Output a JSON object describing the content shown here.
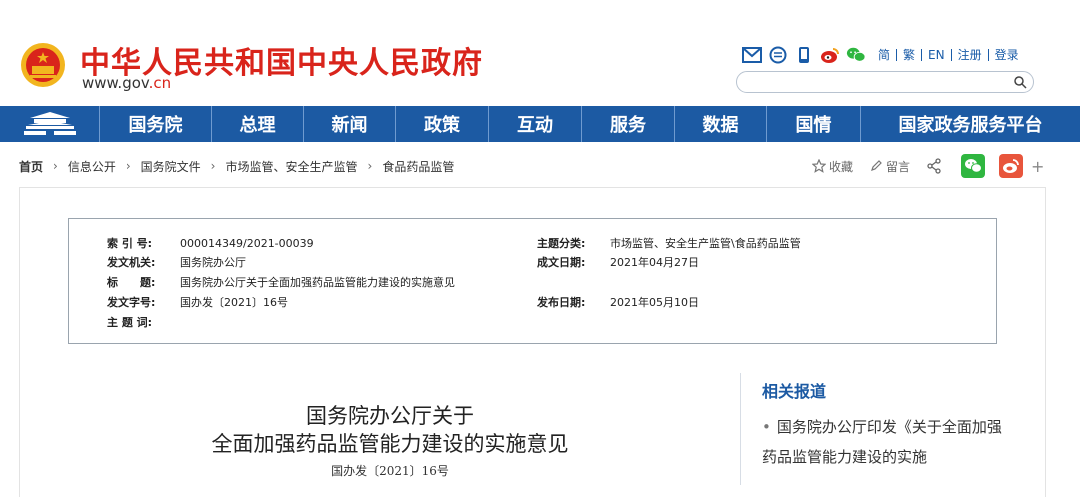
{
  "header": {
    "site_title": "中华人民共和国中央人民政府",
    "url_prefix": "www.gov",
    "url_tld": ".cn",
    "top_links": [
      "简",
      "繁",
      "EN",
      "注册",
      "登录"
    ],
    "search_placeholder": ""
  },
  "nav": {
    "items": [
      "国务院",
      "总理",
      "新闻",
      "政策",
      "互动",
      "服务",
      "数据",
      "国情",
      "国家政务服务平台"
    ]
  },
  "breadcrumb": [
    "首页",
    "信息公开",
    "国务院文件",
    "市场监管、安全生产监管",
    "食品药品监管"
  ],
  "actions": {
    "favorite": "收藏",
    "comment": "留言",
    "more": "+"
  },
  "meta": {
    "index_label": "索 引 号:",
    "index_value": "000014349/2021-00039",
    "topic_label": "主题分类:",
    "topic_value": "市场监管、安全生产监管\\食品药品监管",
    "issuer_label": "发文机关:",
    "issuer_value": "国务院办公厅",
    "created_label": "成文日期:",
    "created_value": "2021年04月27日",
    "title_label": "标　　题:",
    "title_value": "国务院办公厅关于全面加强药品监管能力建设的实施意见",
    "docno_label": "发文字号:",
    "docno_value": "国办发〔2021〕16号",
    "published_label": "发布日期:",
    "published_value": "2021年05月10日",
    "keywords_label": "主 题 词:",
    "keywords_value": ""
  },
  "document": {
    "title_line1": "国务院办公厅关于",
    "title_line2": "全面加强药品监管能力建设的实施意见",
    "doc_number": "国办发〔2021〕16号"
  },
  "related": {
    "title": "相关报道",
    "items": [
      "国务院办公厅印发《关于全面加强药品监管能力建设的实施"
    ]
  },
  "colors": {
    "brand_red": "#d9241b",
    "nav_blue": "#1c5aa3",
    "wechat_green": "#2fb640",
    "weibo_red": "#e8553c"
  }
}
